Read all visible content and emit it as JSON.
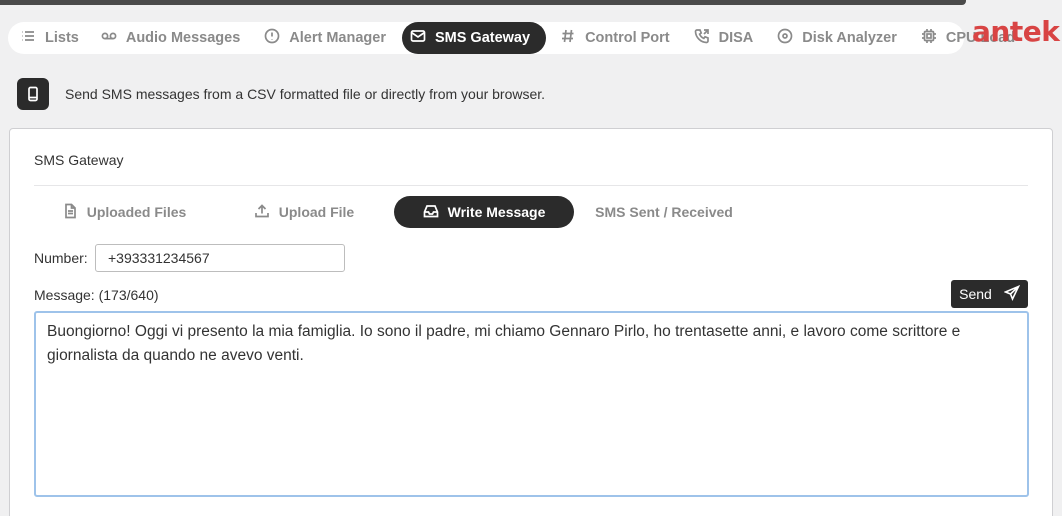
{
  "nav": {
    "items": [
      {
        "label": "Lists",
        "icon": "list-icon"
      },
      {
        "label": "Audio Messages",
        "icon": "voicemail-icon"
      },
      {
        "label": "Alert Manager",
        "icon": "alert-icon"
      },
      {
        "label": "SMS Gateway",
        "icon": "envelope-icon",
        "active": true
      },
      {
        "label": "Control Port",
        "icon": "hash-icon"
      },
      {
        "label": "DISA",
        "icon": "phone-forward-icon"
      },
      {
        "label": "Disk Analyzer",
        "icon": "disk-icon"
      },
      {
        "label": "CPU Load",
        "icon": "cpu-icon"
      }
    ]
  },
  "logo": "antek",
  "info": {
    "text": "Send SMS messages from a CSV formatted file or directly from your browser.",
    "icon": "phone-device-icon"
  },
  "card": {
    "title": "SMS Gateway",
    "tabs": [
      {
        "label": "Uploaded Files",
        "icon": "file-icon"
      },
      {
        "label": "Upload File",
        "icon": "upload-icon"
      },
      {
        "label": "Write Message",
        "icon": "inbox-icon",
        "active": true
      },
      {
        "label": "SMS Sent / Received",
        "icon": ""
      }
    ],
    "number_label": "Number:",
    "number_value": "+393331234567",
    "message_label": "Message: (173/640)",
    "send_label": "Send",
    "message_text": "Buongiorno! Oggi vi presento la mia famiglia. Io sono il padre, mi chiamo Gennaro Pirlo, ho trentasette anni, e lavoro come scrittore e giornalista da quando ne avevo venti."
  },
  "colors": {
    "accent": "#2b2b2b",
    "brand": "#d84444",
    "focus": "#9ec3ea"
  }
}
